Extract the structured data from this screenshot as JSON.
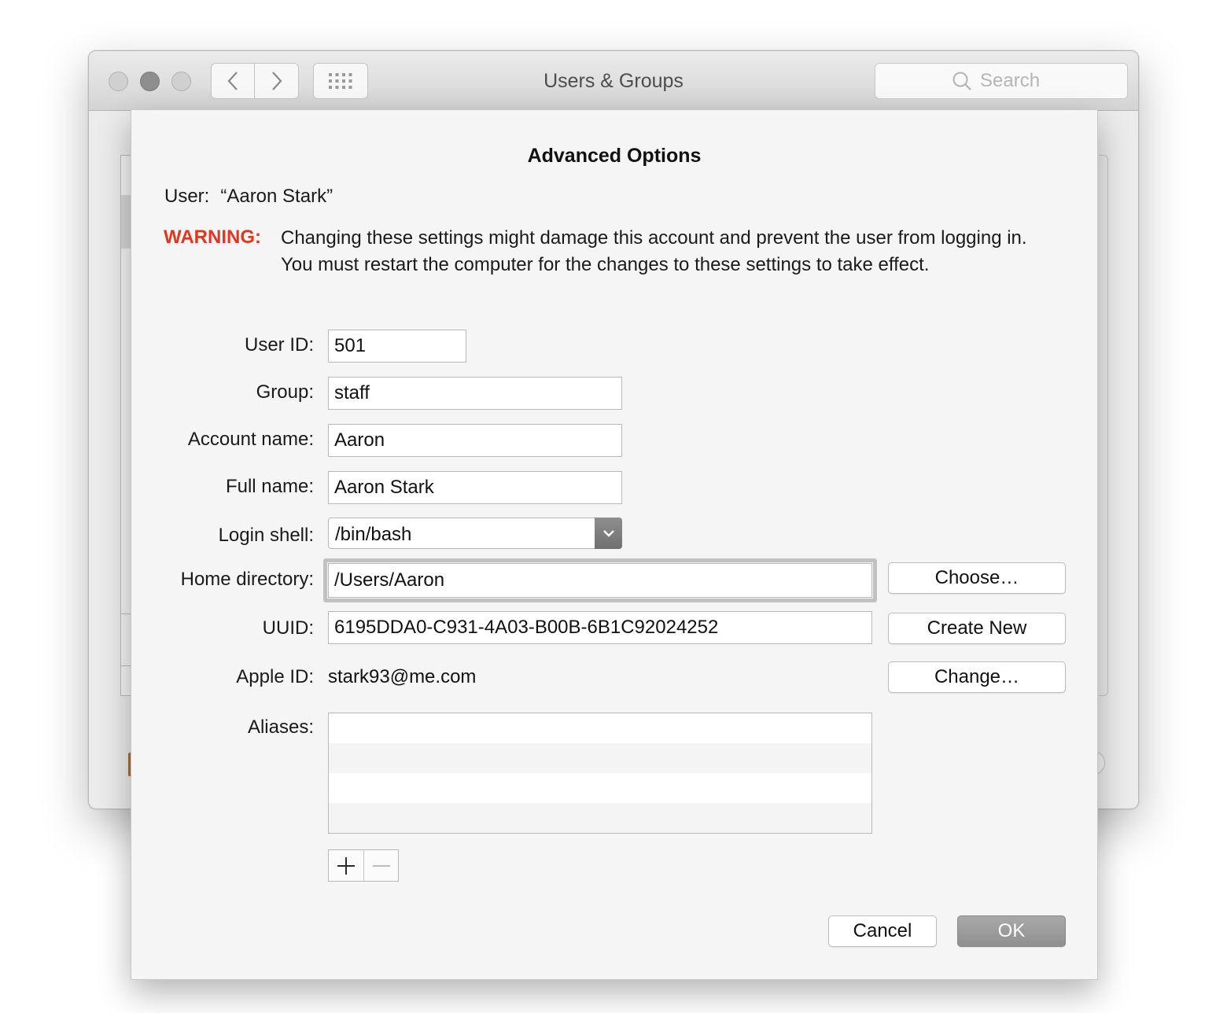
{
  "window": {
    "title": "Users & Groups",
    "search_placeholder": "Search"
  },
  "sheet": {
    "title": "Advanced Options",
    "user_label": "User:",
    "user_name": "“Aaron Stark”",
    "warning_label": "WARNING:",
    "warning_text": "Changing these settings might damage this account and prevent the user from logging in. You must restart the computer for the changes to these settings to take effect.",
    "fields": {
      "user_id": {
        "label": "User ID:",
        "value": "501"
      },
      "group": {
        "label": "Group:",
        "value": "staff"
      },
      "account_name": {
        "label": "Account name:",
        "value": "Aaron"
      },
      "full_name": {
        "label": "Full name:",
        "value": "Aaron Stark"
      },
      "login_shell": {
        "label": "Login shell:",
        "value": "/bin/bash"
      },
      "home_directory": {
        "label": "Home directory:",
        "value": "/Users/Aaron"
      },
      "uuid": {
        "label": "UUID:",
        "value": "6195DDA0-C931-4A03-B00B-6B1C92024252"
      },
      "apple_id": {
        "label": "Apple ID:",
        "value": "stark93@me.com"
      },
      "aliases": {
        "label": "Aliases:",
        "items": []
      }
    },
    "buttons": {
      "choose": "Choose…",
      "create_new": "Create New",
      "change": "Change…",
      "cancel": "Cancel",
      "ok": "OK"
    }
  },
  "colors": {
    "warning": "#e2361f",
    "default_button": "#999999",
    "sheet_background": "#f5f5f5"
  },
  "icons": [
    "back-chevron-icon",
    "forward-chevron-icon",
    "show-all-grid-icon",
    "search-icon",
    "dropdown-chevron-icon",
    "plus-icon",
    "minus-icon"
  ]
}
